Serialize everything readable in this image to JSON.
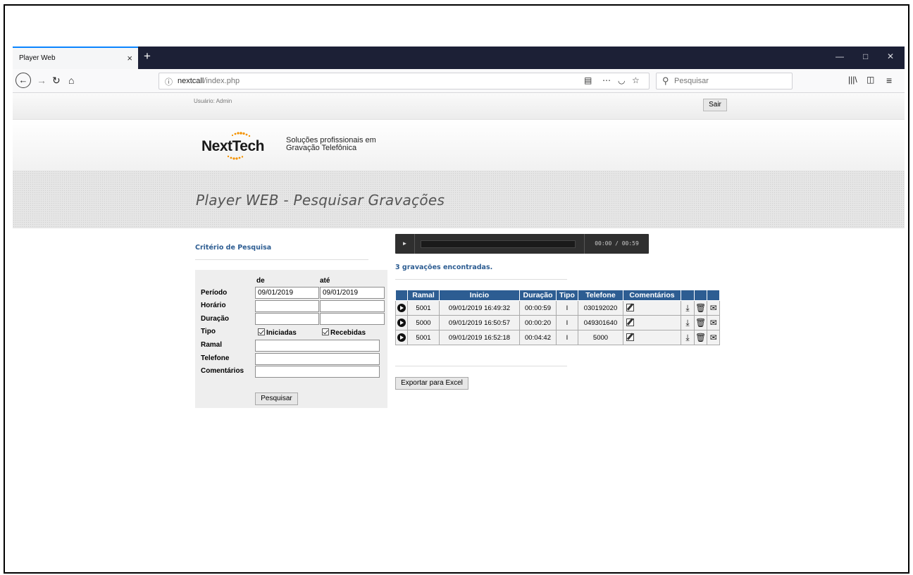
{
  "browser": {
    "tab_title": "Player Web",
    "tab_close": "×",
    "new_tab": "+",
    "window_controls": [
      "—",
      "□",
      "✕"
    ],
    "url_host": "nextcall",
    "url_path": "/index.php",
    "url_info_icon": "ⓘ",
    "search_placeholder": "Pesquisar",
    "icons": [
      "back-arrow-icon",
      "forward-arrow-icon",
      "reload-icon",
      "home-icon",
      "reader-icon",
      "more-icon",
      "pocket-icon",
      "bookmark-star-icon",
      "search-icon",
      "library-icon",
      "sidebar-icon",
      "menu-icon"
    ]
  },
  "header": {
    "user_label": "Usuário: Admin",
    "logout_label": "Sair",
    "logo_text": "NextTech",
    "tagline_line1": "Soluções profissionais em",
    "tagline_line2": "Gravação Telefônica",
    "page_title": "Player WEB - Pesquisar Gravações"
  },
  "search_panel": {
    "title": "Critério de Pesquisa",
    "col_from": "de",
    "col_to": "até",
    "labels": {
      "period": "Período",
      "time": "Horário",
      "duration": "Duração",
      "type": "Tipo",
      "extension": "Ramal",
      "phone": "Telefone",
      "comments": "Comentários"
    },
    "period_from": "09/01/2019",
    "period_to": "09/01/2019",
    "type_initiated": "Iniciadas",
    "type_received": "Recebidas",
    "search_button": "Pesquisar"
  },
  "player": {
    "play_symbol": "►",
    "time_display": "00:00 / 00:59"
  },
  "results": {
    "count_text": "3 gravações encontradas.",
    "headers": [
      "Ramal",
      "Inicio",
      "Duração",
      "Tipo",
      "Telefone",
      "Comentários"
    ],
    "rows": [
      {
        "ramal": "5001",
        "inicio": "09/01/2019 16:49:32",
        "duracao": "00:00:59",
        "tipo": "I",
        "telefone": "030192020"
      },
      {
        "ramal": "5000",
        "inicio": "09/01/2019 16:50:57",
        "duracao": "00:00:20",
        "tipo": "I",
        "telefone": "049301640"
      },
      {
        "ramal": "5001",
        "inicio": "09/01/2019 16:52:18",
        "duracao": "00:04:42",
        "tipo": "I",
        "telefone": "5000"
      }
    ],
    "export_button": "Exportar para Excel"
  },
  "colors": {
    "accent_blue": "#2d5d92",
    "tabbar_dark": "#1c2036",
    "logo_orange": "#f39200"
  }
}
